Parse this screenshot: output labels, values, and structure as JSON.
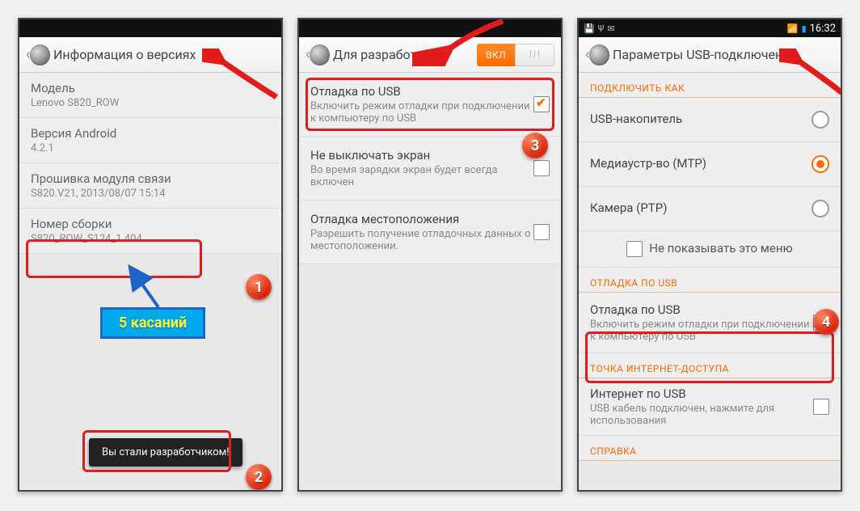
{
  "panel1": {
    "title": "Информация о версиях",
    "model_label": "Модель",
    "model_value": "Lenovo S820_ROW",
    "android_label": "Версия Android",
    "android_value": "4.2.1",
    "baseband_label": "Прошивка модуля связи",
    "baseband_value": "S820.V21, 2013/08/07 15:14",
    "build_label": "Номер сборки",
    "build_value": "S820_ROW_S124_1   404",
    "tap_hint": "5 касаний",
    "toast": "Вы стали разработчиком!"
  },
  "panel2": {
    "title": "Для разработчик…",
    "toggle_on": "ВКЛ",
    "usb_debug_title": "Отладка по USB",
    "usb_debug_sub": "Включить режим отладки при подключении к компьютеру по USB",
    "stay_awake_title": "Не выключать экран",
    "stay_awake_sub": "Во время зарядки экран будет всегда включен",
    "mock_loc_title": "Отладка местоположения",
    "mock_loc_sub": "Разрешить получение отладочных данных о местоположении."
  },
  "panel3": {
    "status_clock": "16:32",
    "title": "Параметры USB-подключения",
    "sect_connect_as": "ПОДКЛЮЧИТЬ КАК",
    "opt_storage": "USB-накопитель",
    "opt_mtp": "Медиаустр-во (MTP)",
    "opt_ptp": "Камера (PTP)",
    "dont_show": "Не показывать это меню",
    "sect_debug": "ОТЛАДКА ПО USB",
    "usb_debug_title": "Отладка по USB",
    "usb_debug_sub": "Включить режим отладки при подключении к компьютеру по USB",
    "sect_tether": "ТОЧКА ИНТЕРНЕТ-ДОСТУПА",
    "tether_title": "Интернет по USB",
    "tether_sub": "USB кабель подключен, нажмите для использования",
    "sect_help": "СПРАВКА"
  },
  "badges": {
    "b1": "1",
    "b2": "2",
    "b3": "3",
    "b4": "4"
  }
}
